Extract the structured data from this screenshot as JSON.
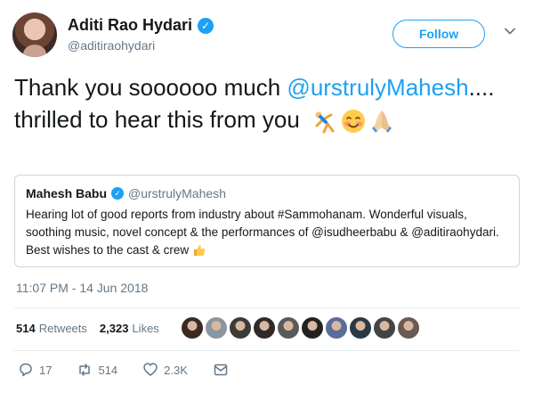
{
  "header": {
    "name": "Aditi Rao Hydari",
    "handle": "@aditiraohydari",
    "follow_label": "Follow"
  },
  "tweet": {
    "text_part1": "Thank you soooooo much ",
    "mention": "@urstrulyMahesh",
    "text_part2": ".... thrilled to hear this from you",
    "emojis": [
      "cartwheel-emoji",
      "blush-emoji",
      "folded-hands-emoji"
    ]
  },
  "quote": {
    "name": "Mahesh Babu",
    "handle": "@urstrulyMahesh",
    "text": "Hearing lot of good reports from industry about #Sammohanam. Wonderful visuals, soothing music, novel concept & the performances of @isudheerbabu & @aditiraohydari. Best wishes to the cast & crew",
    "emoji": "thumbs-up-emoji"
  },
  "timestamp": "11:07 PM - 14 Jun 2018",
  "stats": {
    "retweets_count": "514",
    "retweets_label": "Retweets",
    "likes_count": "2,323",
    "likes_label": "Likes"
  },
  "liker_avatar_colors": [
    "#3a2a22",
    "#8a96a0",
    "#3d3b36",
    "#2f2a28",
    "#5a5a5a",
    "#222222",
    "#5b6b9a",
    "#2a3a45",
    "#444444",
    "#6a5a52"
  ],
  "actions": {
    "reply_count": "17",
    "retweet_count": "514",
    "like_count": "2.3K"
  },
  "colors": {
    "accent": "#1da1f2",
    "secondary_text": "#657786",
    "border": "#ccd6dd"
  }
}
